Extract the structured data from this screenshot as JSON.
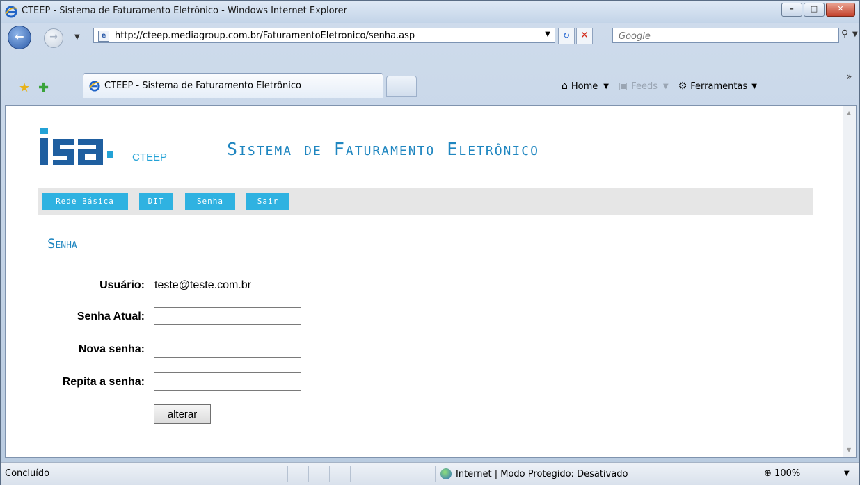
{
  "window": {
    "title": "CTEEP - Sistema de Faturamento Eletrônico - Windows Internet Explorer",
    "minimize_icon": "minimize-icon",
    "maximize_icon": "maximize-icon",
    "close_icon": "close-icon"
  },
  "navbar": {
    "url": "http://cteep.mediagroup.com.br/FaturamentoEletronico/senha.asp",
    "search_placeholder": "Google"
  },
  "tabs": [
    {
      "label": "CTEEP - Sistema de Faturamento Eletrônico"
    }
  ],
  "commandbar": {
    "home": "Home",
    "feeds": "Feeds",
    "tools": "Ferramentas"
  },
  "page": {
    "brand": "CTEEP",
    "app_title": "Sistema de Faturamento Eletrônico",
    "menu": [
      {
        "label": "Rede Básica"
      },
      {
        "label": "DIT"
      },
      {
        "label": "Senha"
      },
      {
        "label": "Sair"
      }
    ],
    "section_title": "Senha",
    "form": {
      "user_label": "Usuário:",
      "user_value": "teste@teste.com.br",
      "current_label": "Senha Atual:",
      "current_value": "",
      "new_label": "Nova senha:",
      "new_value": "",
      "repeat_label": "Repita a senha:",
      "repeat_value": "",
      "submit_label": "alterar"
    }
  },
  "statusbar": {
    "status": "Concluído",
    "zone": "Internet | Modo Protegido: Desativado",
    "zoom": "100%"
  },
  "colors": {
    "accent": "#1f86c0",
    "menu_bg": "#2fb2e1",
    "menubar_bg": "#e6e6e6"
  }
}
